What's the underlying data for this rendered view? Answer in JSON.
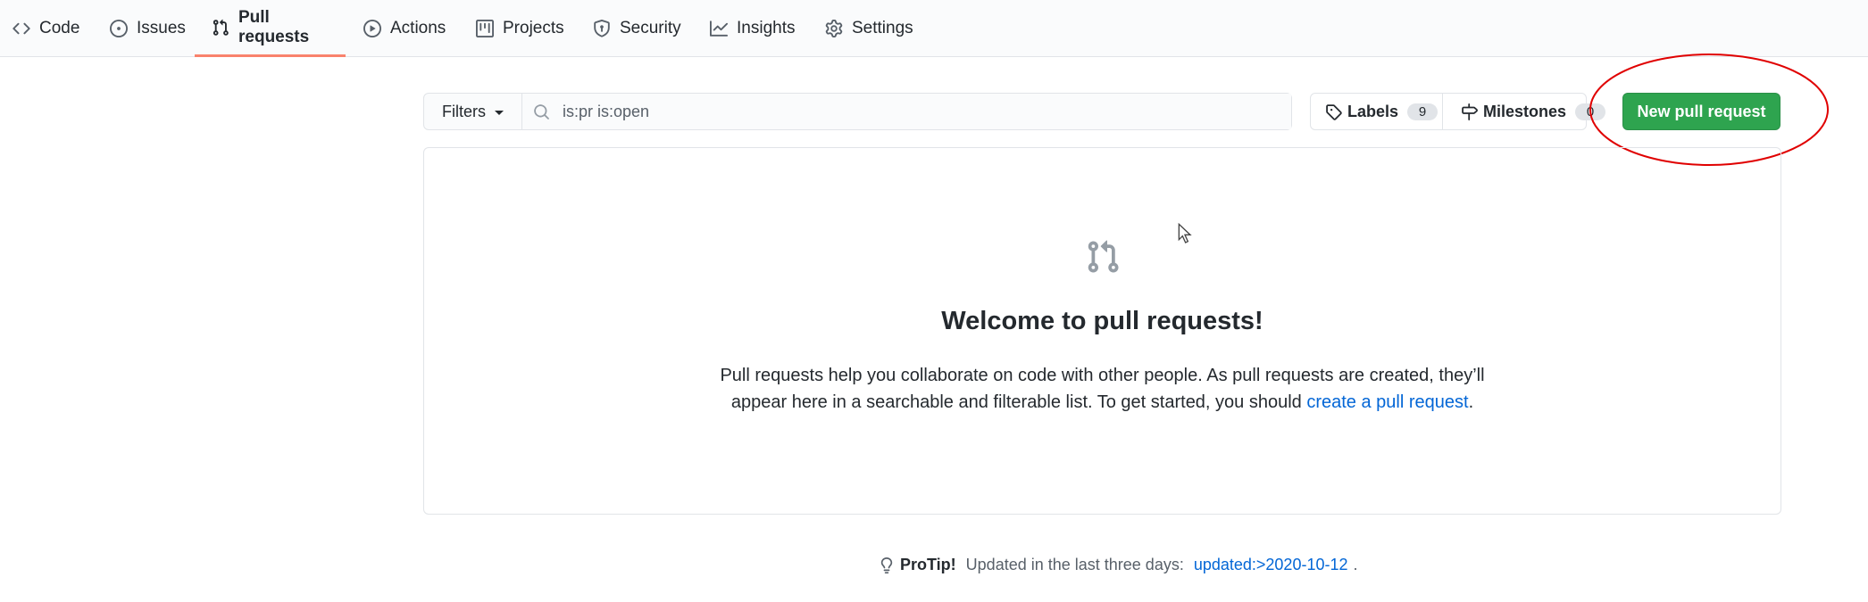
{
  "repo_nav": {
    "items": [
      {
        "label": "Code",
        "icon": "code-icon",
        "selected": false
      },
      {
        "label": "Issues",
        "icon": "issue-opened-icon",
        "selected": false
      },
      {
        "label": "Pull requests",
        "icon": "git-pull-request-icon",
        "selected": true
      },
      {
        "label": "Actions",
        "icon": "play-icon",
        "selected": false
      },
      {
        "label": "Projects",
        "icon": "project-icon",
        "selected": false
      },
      {
        "label": "Security",
        "icon": "shield-icon",
        "selected": false
      },
      {
        "label": "Insights",
        "icon": "graph-icon",
        "selected": false
      },
      {
        "label": "Settings",
        "icon": "gear-icon",
        "selected": false
      }
    ]
  },
  "subnav": {
    "filters_label": "Filters",
    "search_value": "is:pr is:open",
    "labels_label": "Labels",
    "labels_count": "9",
    "milestones_label": "Milestones",
    "milestones_count": "0",
    "new_pr_label": "New pull request"
  },
  "blankslate": {
    "icon": "git-pull-request-icon",
    "title": "Welcome to pull requests!",
    "text_line1": "Pull requests help you collaborate on code with other people. As pull requests are created, they’ll",
    "text_line2_prefix": "appear here in a searchable and filterable list. To get started, you should ",
    "text_link": "create a pull request",
    "text_suffix": "."
  },
  "protip": {
    "label": "ProTip!",
    "text": " Updated in the last three days: ",
    "link": "updated:>2020-10-12",
    "suffix": "."
  },
  "colors": {
    "accent_underline": "#f9826c",
    "primary_button": "#2ea44f",
    "link": "#0366d6",
    "annotation": "#e00000"
  }
}
